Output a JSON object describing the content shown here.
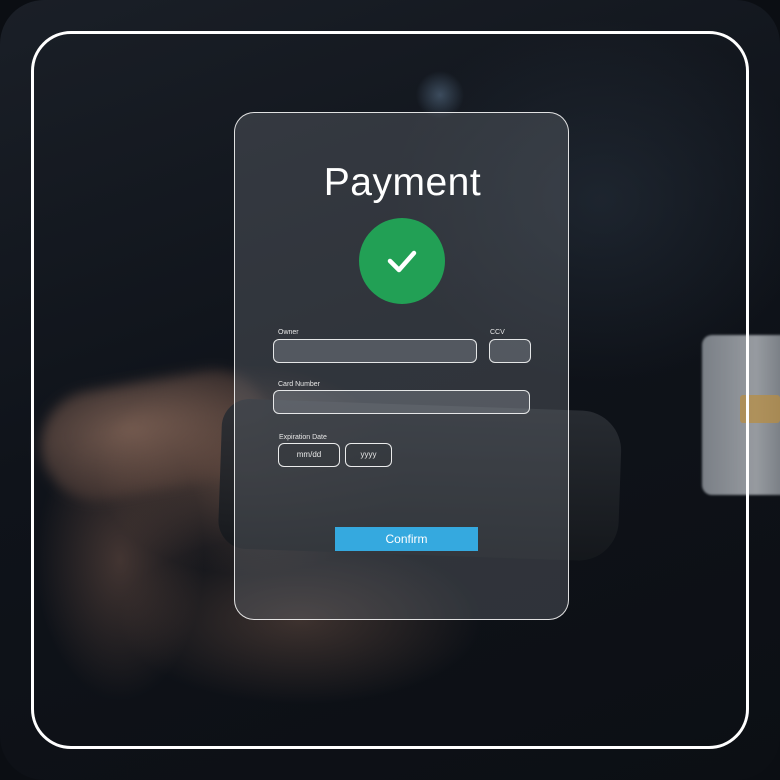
{
  "payment": {
    "title": "Payment",
    "status_icon": "checkmark-icon",
    "owner_label": "Owner",
    "ccv_label": "CCV",
    "card_number_label": "Card Number",
    "expiration_label": "Expiration Date",
    "month_placeholder": "mm/dd",
    "year_placeholder": "yyyy",
    "confirm_label": "Confirm"
  },
  "colors": {
    "success_green": "#22a055",
    "confirm_blue": "#35a9df",
    "frame_border": "#ffffff"
  }
}
